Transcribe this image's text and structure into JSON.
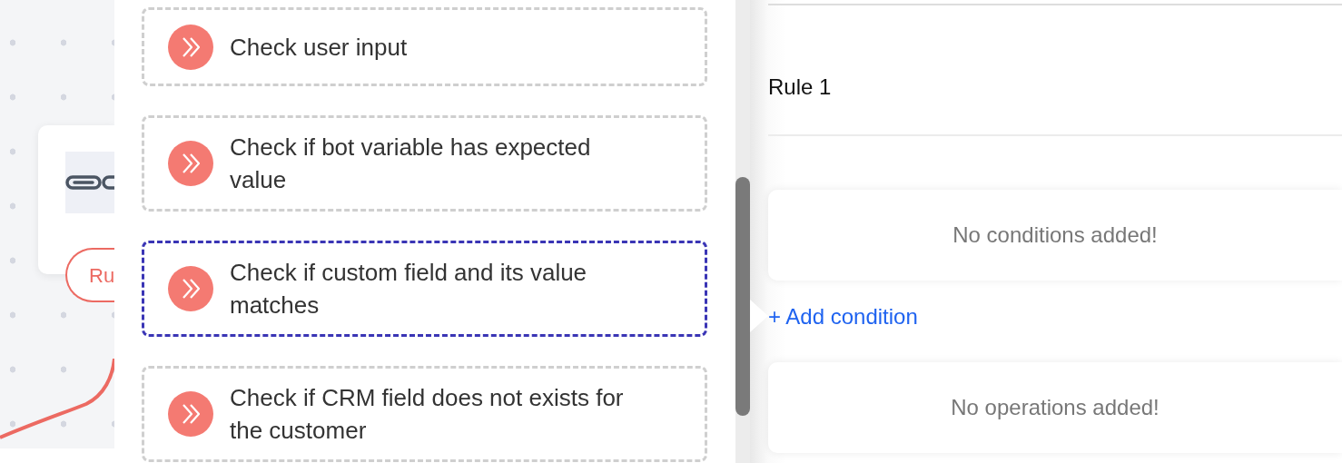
{
  "canvas": {
    "node": {
      "kind": "link",
      "pill": "Ru"
    }
  },
  "options": [
    {
      "label": "Check user input",
      "selected": false
    },
    {
      "label": "Check if bot variable has expected value",
      "selected": false
    },
    {
      "label": "Check if custom field and its value matches",
      "selected": true
    },
    {
      "label": "Check if CRM field does not exists for the customer",
      "selected": false
    }
  ],
  "rule": {
    "title": "Rule 1",
    "conditions_empty": "No conditions added!",
    "add_condition": "+ Add condition",
    "operations_empty": "No operations added!"
  }
}
